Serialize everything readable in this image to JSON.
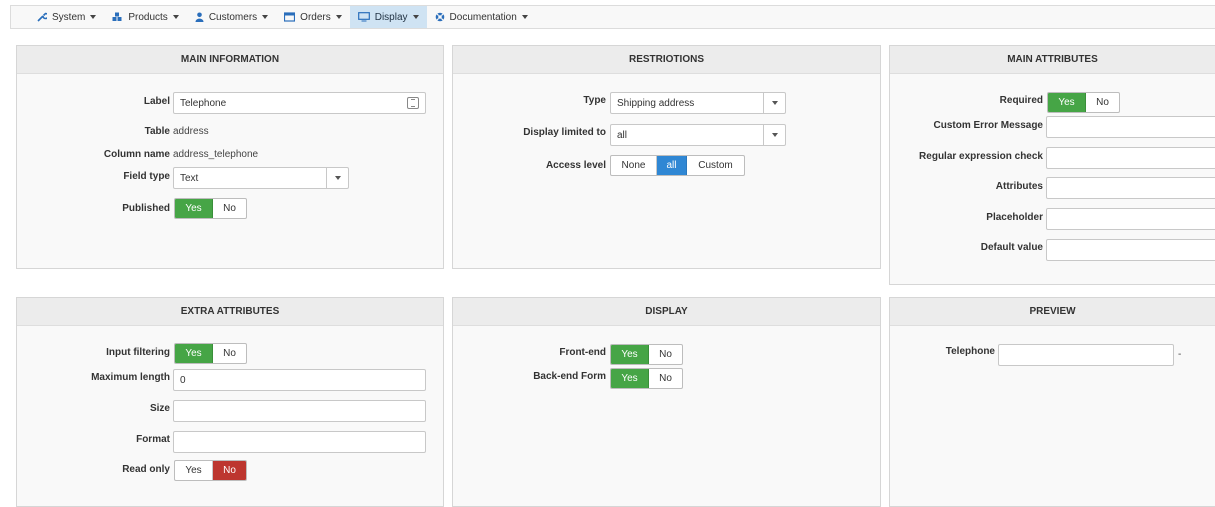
{
  "nav": [
    {
      "label": "System",
      "icon": "wrench-icon"
    },
    {
      "label": "Products",
      "icon": "cubes-icon"
    },
    {
      "label": "Customers",
      "icon": "user-icon"
    },
    {
      "label": "Orders",
      "icon": "orders-icon"
    },
    {
      "label": "Display",
      "icon": "monitor-icon",
      "active": true
    },
    {
      "label": "Documentation",
      "icon": "lifebuoy-icon"
    }
  ],
  "main_information": {
    "title": "MAIN INFORMATION",
    "label_label": "Label",
    "label_value": "Telephone",
    "table_label": "Table",
    "table_value": "address",
    "column_label": "Column name",
    "column_value": "address_telephone",
    "field_type_label": "Field type",
    "field_type_value": "Text",
    "published_label": "Published",
    "yes": "Yes",
    "no": "No"
  },
  "restrictions": {
    "title": "RESTRIOTIONS",
    "type_label": "Type",
    "type_value": "Shipping address",
    "display_limited_label": "Display limited to",
    "display_limited_value": "all",
    "access_level_label": "Access level",
    "access_none": "None",
    "access_all": "all",
    "access_custom": "Custom"
  },
  "main_attributes": {
    "title": "MAIN ATTRIBUTES",
    "required_label": "Required",
    "yes": "Yes",
    "no": "No",
    "custom_error_label": "Custom Error Message",
    "regex_label": "Regular expression check",
    "attributes_label": "Attributes",
    "placeholder_label": "Placeholder",
    "default_value_label": "Default value"
  },
  "extra_attributes": {
    "title": "EXTRA ATTRIBUTES",
    "input_filtering_label": "Input filtering",
    "max_length_label": "Maximum length",
    "max_length_value": "0",
    "size_label": "Size",
    "format_label": "Format",
    "read_only_label": "Read only",
    "yes": "Yes",
    "no": "No"
  },
  "display": {
    "title": "DISPLAY",
    "front_end_label": "Front-end",
    "back_end_label": "Back-end Form",
    "yes": "Yes",
    "no": "No"
  },
  "preview": {
    "title": "PREVIEW",
    "telephone_label": "Telephone",
    "trailing": "-"
  },
  "colors": {
    "green": "#46a546",
    "red": "#bd362f",
    "blue": "#2f87d4"
  }
}
